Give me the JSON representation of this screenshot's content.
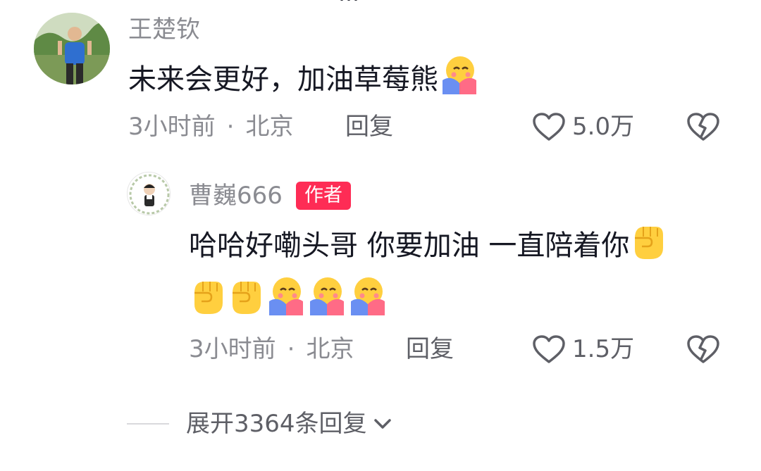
{
  "top_clip": "…",
  "comment": {
    "username": "王楚钦",
    "content": "未来会更好，加油草莓熊",
    "time": "3小时前",
    "location": "北京",
    "reply_label": "回复",
    "like_count": "5.0万"
  },
  "reply": {
    "username": "曹巍666",
    "badge": "作者",
    "content_line1": "哈哈好嘞头哥 你要加油 一直陪着你",
    "time": "3小时前",
    "location": "北京",
    "reply_label": "回复",
    "like_count": "1.5万"
  },
  "expand_label": "展开3364条回复",
  "emojis": [
    "hug-emoji",
    "fist-emoji"
  ],
  "colors": {
    "author_badge": "#fe2c55",
    "meta": "#8a8b91",
    "text": "#161823"
  }
}
